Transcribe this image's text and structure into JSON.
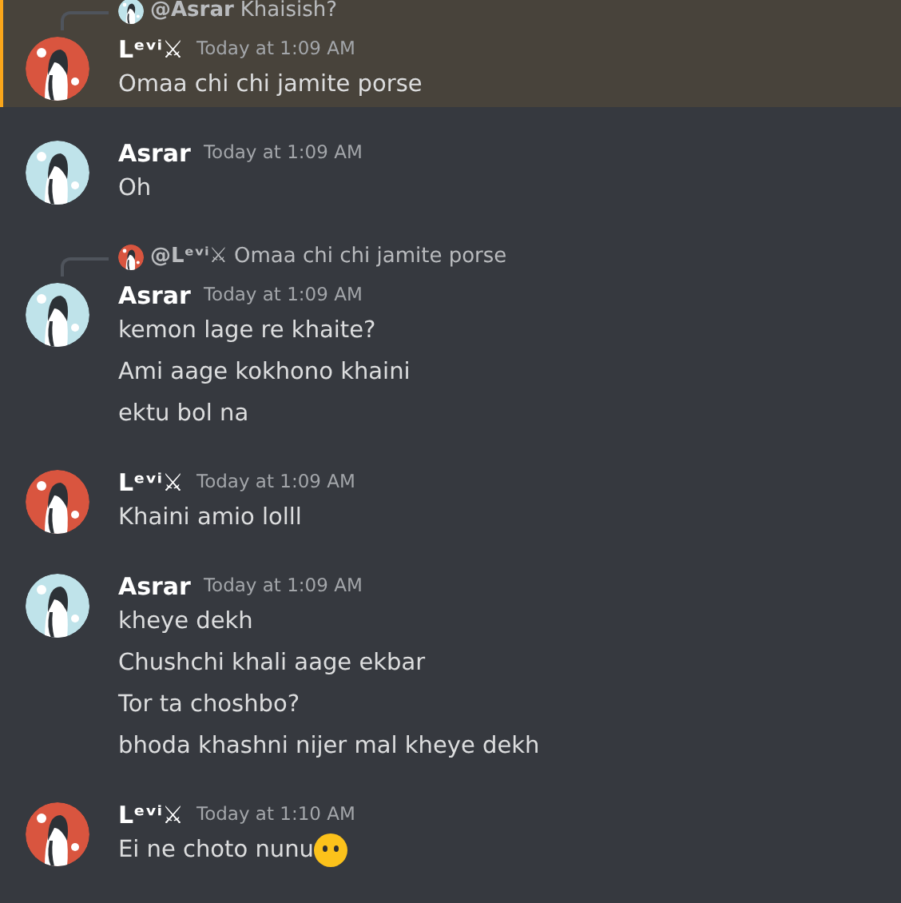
{
  "messages": [
    {
      "highlighted": true,
      "reply": {
        "avatar": {
          "kind": "picture",
          "color": "#bfe3ea"
        },
        "author": "@Asrar",
        "text": "Khaisish?"
      },
      "avatar": {
        "kind": "picture",
        "color": "#d9553f"
      },
      "author": "Lᵉᵛⁱ⚔",
      "time": "Today at 1:09 AM",
      "lines": [
        {
          "text": "Omaa chi chi jamite porse"
        }
      ]
    },
    {
      "highlighted": false,
      "avatar": {
        "kind": "picture",
        "color": "#bfe3ea"
      },
      "author": "Asrar",
      "time": "Today at 1:09 AM",
      "lines": [
        {
          "text": "Oh"
        }
      ]
    },
    {
      "highlighted": false,
      "reply": {
        "avatar": {
          "kind": "picture",
          "color": "#d9553f"
        },
        "author": "@Lᵉᵛⁱ⚔",
        "text": "Omaa chi chi jamite porse"
      },
      "avatar": {
        "kind": "picture",
        "color": "#bfe3ea"
      },
      "author": "Asrar",
      "time": "Today at 1:09 AM",
      "lines": [
        {
          "text": "kemon lage re khaite?"
        },
        {
          "text": "Ami aage kokhono khaini"
        },
        {
          "text": "ektu bol na"
        }
      ]
    },
    {
      "highlighted": false,
      "avatar": {
        "kind": "picture",
        "color": "#d9553f"
      },
      "author": "Lᵉᵛⁱ⚔",
      "time": "Today at 1:09 AM",
      "lines": [
        {
          "text": "Khaini amio lolll"
        }
      ]
    },
    {
      "highlighted": false,
      "avatar": {
        "kind": "picture",
        "color": "#bfe3ea"
      },
      "author": "Asrar",
      "time": "Today at 1:09 AM",
      "lines": [
        {
          "text": "kheye dekh"
        },
        {
          "text": "Chushchi khali aage ekbar"
        },
        {
          "text": "Tor ta choshbo?"
        },
        {
          "text": "bhoda khashni nijer mal kheye dekh"
        }
      ]
    },
    {
      "highlighted": false,
      "avatar": {
        "kind": "picture",
        "color": "#d9553f"
      },
      "author": "Lᵉᵛⁱ⚔",
      "time": "Today at 1:10 AM",
      "lines": [
        {
          "text": "Ei ne choto nunu",
          "emoji": true
        }
      ]
    }
  ]
}
